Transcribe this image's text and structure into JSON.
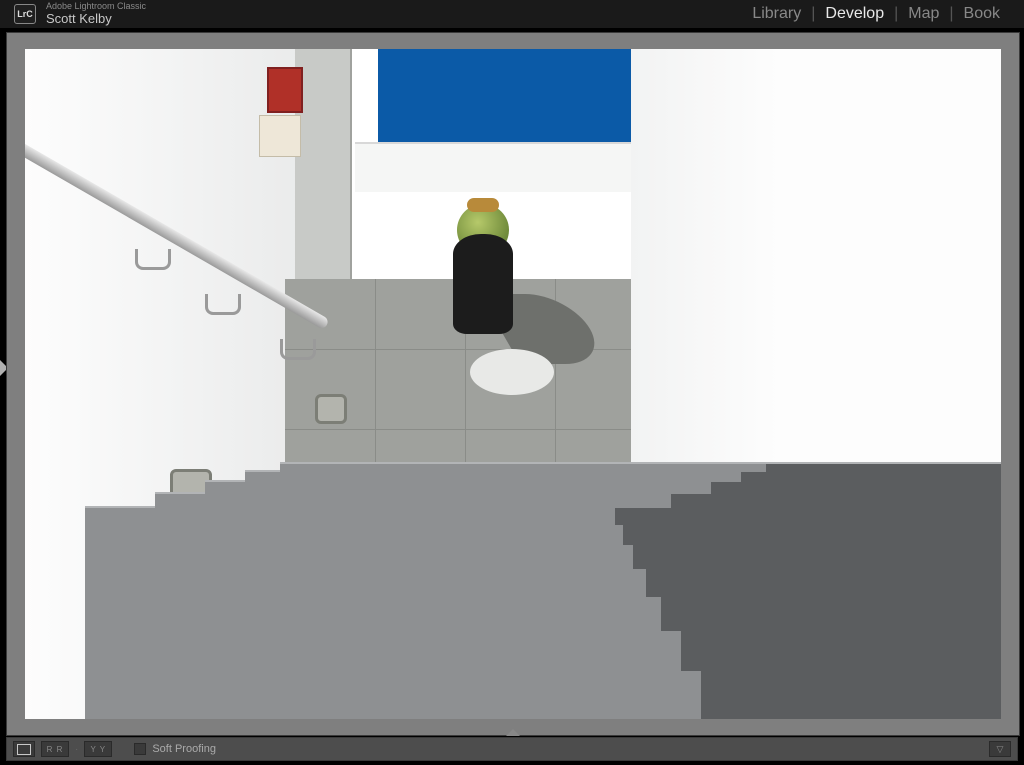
{
  "header": {
    "logo_text": "LrC",
    "app_title": "Adobe Lightroom Classic",
    "user_name": "Scott Kelby"
  },
  "modules": {
    "library": "Library",
    "develop": "Develop",
    "map": "Map",
    "book": "Book",
    "active": "develop",
    "separator": "|"
  },
  "toolbar": {
    "before_after_rr": "R R",
    "before_after_yy": "Y Y",
    "separator": "·",
    "soft_proofing_label": "Soft Proofing",
    "soft_proofing_checked": false,
    "dropdown_glyph": "▽"
  }
}
